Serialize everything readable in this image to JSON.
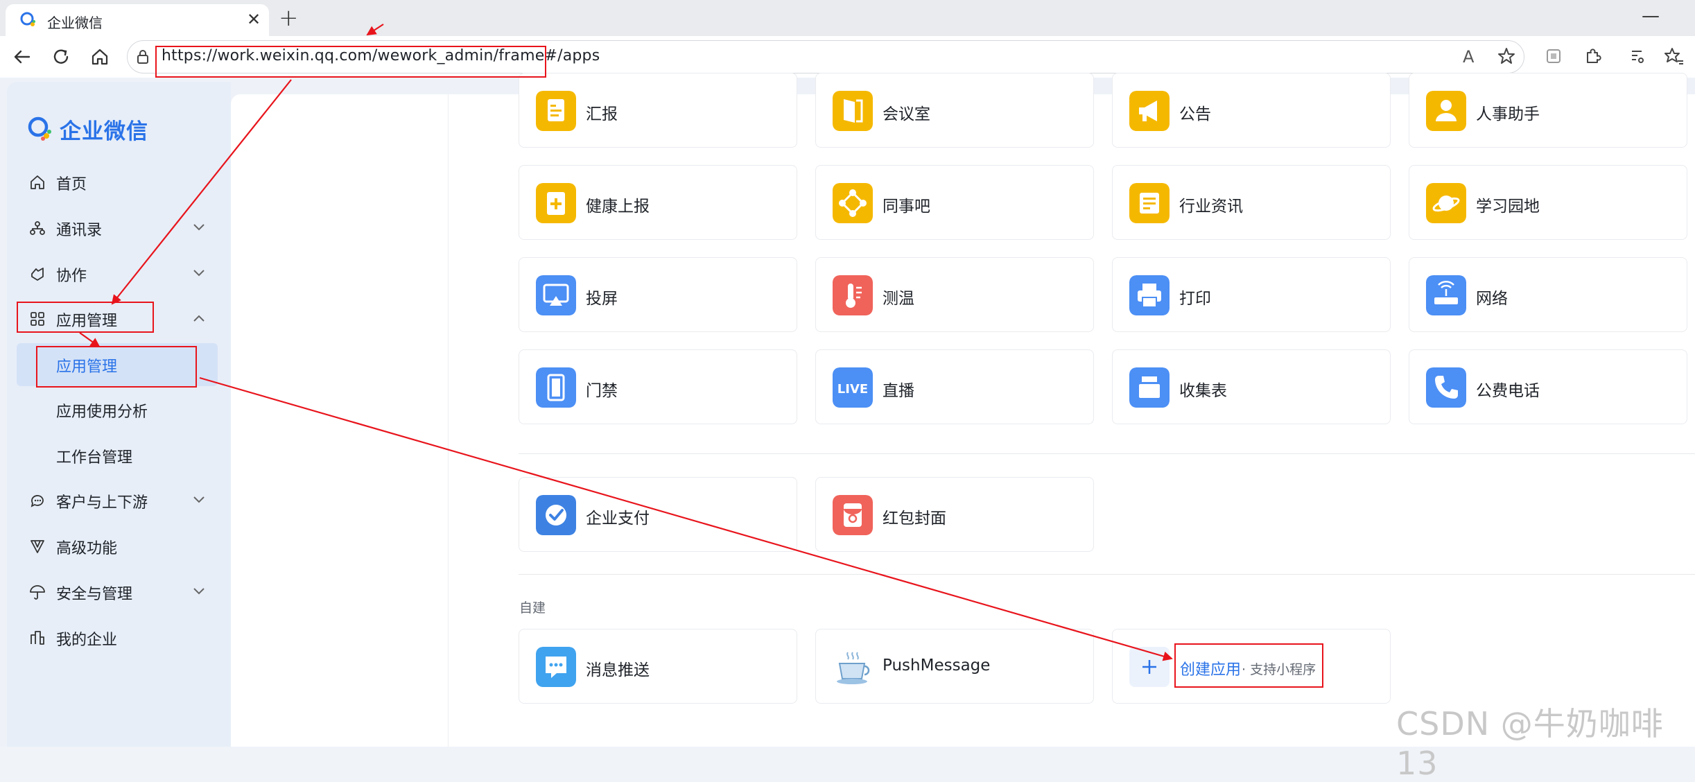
{
  "browser": {
    "tab_title": "企业微信",
    "url": "https://work.weixin.qq.com/wework_admin/frame#/apps"
  },
  "sidebar": {
    "logo_text": "企业微信",
    "items": [
      {
        "label": "首页",
        "icon": "home-icon",
        "expandable": false
      },
      {
        "label": "通讯录",
        "icon": "contacts-icon",
        "expandable": true
      },
      {
        "label": "协作",
        "icon": "collaboration-icon",
        "expandable": true
      },
      {
        "label": "应用管理",
        "icon": "grid-icon",
        "expandable": true,
        "expanded": true
      }
    ],
    "sub_items": [
      {
        "label": "应用管理",
        "active": true
      },
      {
        "label": "应用使用分析",
        "active": false
      },
      {
        "label": "工作台管理",
        "active": false
      }
    ],
    "items_after": [
      {
        "label": "客户与上下游",
        "icon": "chat-bubble-icon",
        "expandable": true
      },
      {
        "label": "高级功能",
        "icon": "funnel-icon",
        "expandable": false
      },
      {
        "label": "安全与管理",
        "icon": "umbrella-icon",
        "expandable": true
      },
      {
        "label": "我的企业",
        "icon": "building-icon",
        "expandable": false
      }
    ]
  },
  "apps": {
    "rows": [
      [
        "汇报",
        "会议室",
        "公告",
        "人事助手"
      ],
      [
        "健康上报",
        "同事吧",
        "行业资讯",
        "学习园地"
      ],
      [
        "投屏",
        "测温",
        "打印",
        "网络"
      ],
      [
        "门禁",
        "直播",
        "收集表",
        "公费电话"
      ]
    ],
    "finance": [
      "企业支付",
      "红包封面"
    ],
    "custom_section_title": "自建",
    "custom": [
      "消息推送",
      "PushMessage"
    ],
    "create_label": "创建应用",
    "create_sub": "· 支持小程序"
  },
  "colors": {
    "accent": "#2a73e8",
    "annotation": "#e8141c",
    "yellow_icon": "#f5b800",
    "blue_icon": "#4c8ff5",
    "red_icon": "#f0635a"
  },
  "watermark": "CSDN @牛奶咖啡13"
}
